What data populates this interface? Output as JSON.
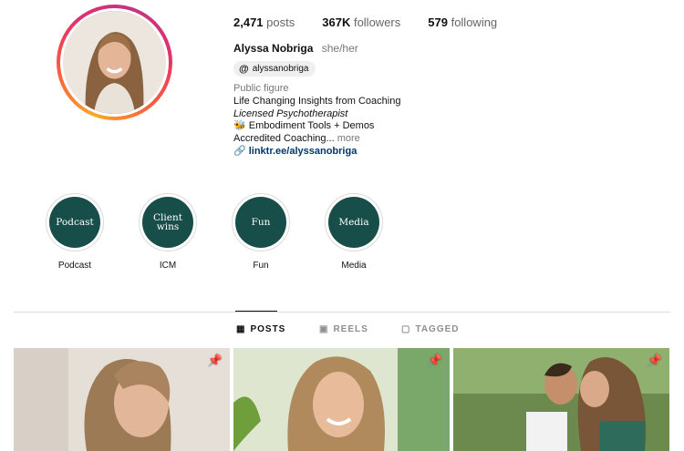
{
  "profile": {
    "posts_count": "2,471",
    "posts_label": "posts",
    "followers_count": "367K",
    "followers_label": "followers",
    "following_count": "579",
    "following_label": "following",
    "name": "Alyssa Nobriga",
    "pronouns": "she/her",
    "threads_handle": "alyssanobriga",
    "category": "Public figure",
    "bio_line1": "Life Changing Insights from Coaching",
    "bio_line2": "Licensed Psychotherapist",
    "bio_line3_emoji": "🐝",
    "bio_line3": "Embodiment Tools + Demos",
    "bio_line4": "Accredited Coaching...",
    "more_label": "more",
    "link_text": "linktr.ee/alyssanobriga"
  },
  "highlights": [
    {
      "cover": "Podcast",
      "label": "Podcast"
    },
    {
      "cover": "Client wins",
      "label": "ICM"
    },
    {
      "cover": "Fun",
      "label": "Fun"
    },
    {
      "cover": "Media",
      "label": "Media"
    }
  ],
  "tabs": {
    "posts": "POSTS",
    "reels": "REELS",
    "tagged": "TAGGED"
  },
  "colors": {
    "highlight_bg": "#184e4a",
    "link": "#00376b"
  }
}
